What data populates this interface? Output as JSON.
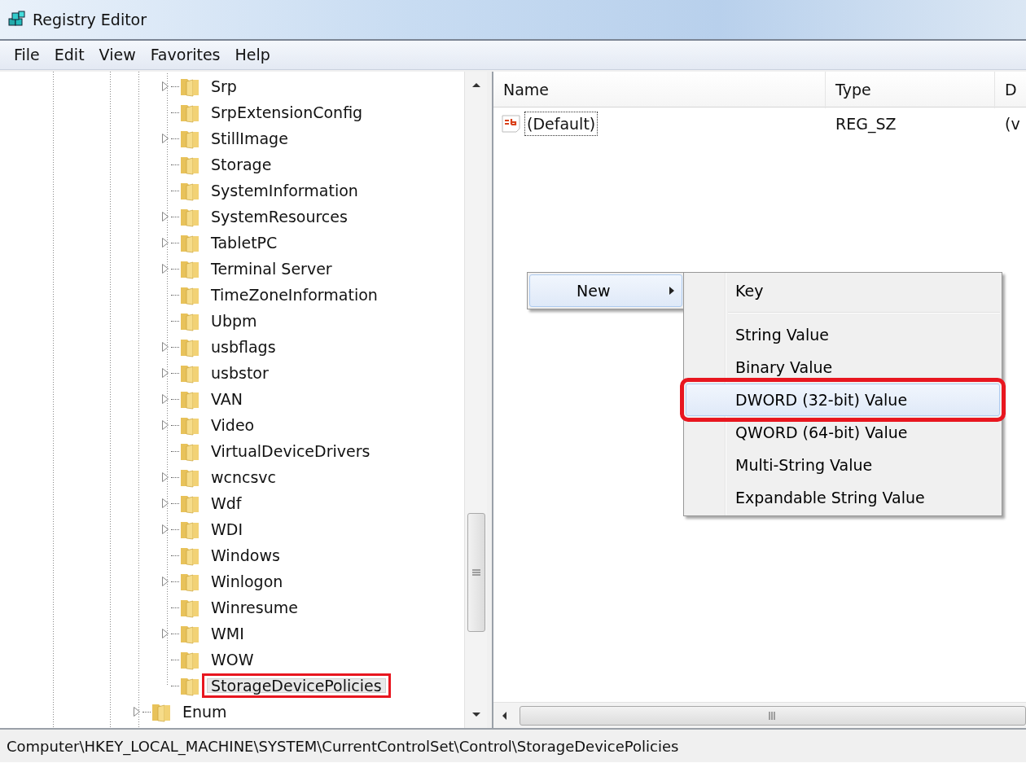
{
  "window": {
    "title": "Registry Editor"
  },
  "menu_bar": [
    "File",
    "Edit",
    "View",
    "Favorites",
    "Help"
  ],
  "tree": {
    "items": [
      {
        "children": [
          {
            "label": "Srp",
            "expandable": true,
            "selected": false,
            "annotated": false
          },
          {
            "label": "SrpExtensionConfig",
            "expandable": false,
            "selected": false,
            "annotated": false
          },
          {
            "label": "StillImage",
            "expandable": true,
            "selected": false,
            "annotated": false
          },
          {
            "label": "Storage",
            "expandable": false,
            "selected": false,
            "annotated": false
          },
          {
            "label": "SystemInformation",
            "expandable": false,
            "selected": false,
            "annotated": false
          },
          {
            "label": "SystemResources",
            "expandable": true,
            "selected": false,
            "annotated": false
          },
          {
            "label": "TabletPC",
            "expandable": true,
            "selected": false,
            "annotated": false
          },
          {
            "label": "Terminal Server",
            "expandable": true,
            "selected": false,
            "annotated": false
          },
          {
            "label": "TimeZoneInformation",
            "expandable": false,
            "selected": false,
            "annotated": false
          },
          {
            "label": "Ubpm",
            "expandable": false,
            "selected": false,
            "annotated": false
          },
          {
            "label": "usbflags",
            "expandable": true,
            "selected": false,
            "annotated": false
          },
          {
            "label": "usbstor",
            "expandable": true,
            "selected": false,
            "annotated": false
          },
          {
            "label": "VAN",
            "expandable": true,
            "selected": false,
            "annotated": false
          },
          {
            "label": "Video",
            "expandable": true,
            "selected": false,
            "annotated": false
          },
          {
            "label": "VirtualDeviceDrivers",
            "expandable": false,
            "selected": false,
            "annotated": false
          },
          {
            "label": "wcncsvc",
            "expandable": true,
            "selected": false,
            "annotated": false
          },
          {
            "label": "Wdf",
            "expandable": true,
            "selected": false,
            "annotated": false
          },
          {
            "label": "WDI",
            "expandable": true,
            "selected": false,
            "annotated": false
          },
          {
            "label": "Windows",
            "expandable": false,
            "selected": false,
            "annotated": false
          },
          {
            "label": "Winlogon",
            "expandable": true,
            "selected": false,
            "annotated": false
          },
          {
            "label": "Winresume",
            "expandable": false,
            "selected": false,
            "annotated": false
          },
          {
            "label": "WMI",
            "expandable": true,
            "selected": false,
            "annotated": false
          },
          {
            "label": "WOW",
            "expandable": false,
            "selected": false,
            "annotated": false
          },
          {
            "label": "StorageDevicePolicies",
            "expandable": false,
            "selected": true,
            "annotated": true
          }
        ]
      },
      {
        "label": "Enum",
        "expandable": true,
        "selected": false,
        "annotated": false
      }
    ]
  },
  "values_list": {
    "columns": [
      "Name",
      "Type",
      "D"
    ],
    "rows": [
      {
        "name": "(Default)",
        "type": "REG_SZ",
        "data": "(v",
        "focused": true
      }
    ]
  },
  "context_menu": {
    "items": [
      {
        "label": "New",
        "has_submenu": true,
        "highlighted": true
      }
    ],
    "submenu": {
      "items": [
        {
          "kind": "item",
          "label": "Key",
          "highlighted": false,
          "annotated": false
        },
        {
          "kind": "separator"
        },
        {
          "kind": "item",
          "label": "String Value",
          "highlighted": false,
          "annotated": false
        },
        {
          "kind": "item",
          "label": "Binary Value",
          "highlighted": false,
          "annotated": false
        },
        {
          "kind": "item",
          "label": "DWORD (32-bit) Value",
          "highlighted": true,
          "annotated": true
        },
        {
          "kind": "item",
          "label": "QWORD (64-bit) Value",
          "highlighted": false,
          "annotated": false
        },
        {
          "kind": "item",
          "label": "Multi-String Value",
          "highlighted": false,
          "annotated": false
        },
        {
          "kind": "item",
          "label": "Expandable String Value",
          "highlighted": false,
          "annotated": false
        }
      ]
    }
  },
  "status_bar": "Computer\\HKEY_LOCAL_MACHINE\\SYSTEM\\CurrentControlSet\\Control\\StorageDevicePolicies"
}
